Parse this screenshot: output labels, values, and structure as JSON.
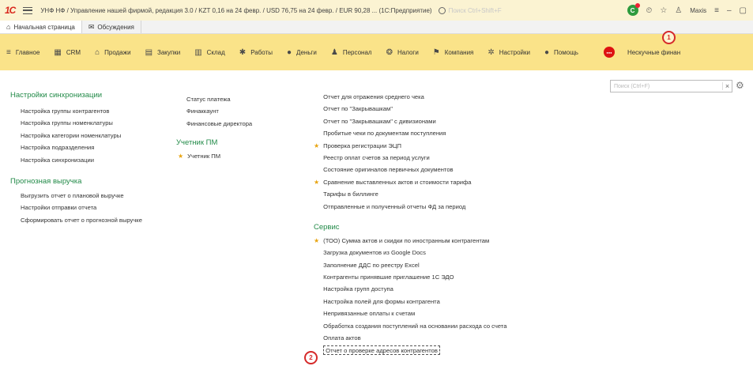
{
  "titlebar": {
    "logo": "1С",
    "title": "УНФ НФ / Управление нашей фирмой, редакция 3.0 / KZT 0,16 на 24 февр. / USD 76,75 на 24 февр. / EUR 90,28 ...   (1С:Предприятие)",
    "search_placeholder": "Поиск Ctrl+Shift+F",
    "user": "Maxis"
  },
  "tabs": [
    {
      "label": "Начальная страница",
      "icon": "home-icon"
    },
    {
      "label": "Обсуждения",
      "icon": "chat-icon"
    }
  ],
  "nav": [
    {
      "label": "Главное",
      "icon": "menu-icon"
    },
    {
      "label": "CRM",
      "icon": "crm-icon"
    },
    {
      "label": "Продажи",
      "icon": "shop-icon"
    },
    {
      "label": "Закупки",
      "icon": "purchase-icon"
    },
    {
      "label": "Склад",
      "icon": "warehouse-icon"
    },
    {
      "label": "Работы",
      "icon": "works-icon"
    },
    {
      "label": "Деньги",
      "icon": "money-icon"
    },
    {
      "label": "Персонал",
      "icon": "staff-icon"
    },
    {
      "label": "Налоги",
      "icon": "tax-icon"
    },
    {
      "label": "Компания",
      "icon": "flag-icon"
    },
    {
      "label": "Настройки",
      "icon": "gear-icon"
    },
    {
      "label": "Помощь",
      "icon": "help-icon"
    }
  ],
  "nav_extra": "Нескучные финан",
  "annotations": [
    "1",
    "2"
  ],
  "content": {
    "search_placeholder": "Поиск (Ctrl+F)",
    "col1": {
      "section1_title": "Настройки синхронизации",
      "section1_items": [
        "Настройка группы контрагентов",
        "Настройка группы номенклатуры",
        "Настройка категории номенклатуры",
        "Настройка подразделения",
        "Настройка синхронизации"
      ],
      "section2_title": "Прогнозная выручка",
      "section2_items": [
        "Выгрузить отчет о плановой выручке",
        "Настройки отправки отчета",
        "Сформировать отчет о прогнозной выручке"
      ]
    },
    "col2": {
      "items": [
        "Статус платежа",
        "Финаккаунт",
        "Финансовые директора"
      ],
      "section_title": "Учетник ПМ",
      "section_items": [
        "Учетник ПМ"
      ]
    },
    "col3": {
      "items": [
        {
          "label": "Отчет для отражения среднего чека",
          "star": false
        },
        {
          "label": "Отчет по \"Закрывашкам\"",
          "star": false
        },
        {
          "label": "Отчет по \"Закрывашкам\" с дивизионами",
          "star": false
        },
        {
          "label": "Пробитые чеки по документам поступления",
          "star": false
        },
        {
          "label": "Проверка регистрации ЭЦП",
          "star": true
        },
        {
          "label": "Реестр оплат счетов за период услуги",
          "star": false
        },
        {
          "label": "Состояние оригиналов первичных документов",
          "star": false
        },
        {
          "label": "Сравнение выставленных актов и стоимости тарифа",
          "star": true
        },
        {
          "label": "Тарифы в биллинге",
          "star": false
        },
        {
          "label": "Отправленные и полученный отчеты ФД за период",
          "star": false
        }
      ],
      "section_title": "Сервис",
      "section_items": [
        {
          "label": "(ТОО) Сумма актов и скидки по иностранным контрагентам",
          "star": true
        },
        {
          "label": "Загрузка документов из Google Docs",
          "star": false
        },
        {
          "label": "Заполнение ДДС по реестру Excel",
          "star": false
        },
        {
          "label": "Контрагенты принявшие приглашение 1С ЭДО",
          "star": false
        },
        {
          "label": "Настройка групп доступа",
          "star": false
        },
        {
          "label": "Настройка полей для формы контрагента",
          "star": false
        },
        {
          "label": "Непривязанные оплаты к счетам",
          "star": false
        },
        {
          "label": "Обработка создания поступлений на основании расхода со счета",
          "star": false
        },
        {
          "label": "Оплата актов",
          "star": false
        },
        {
          "label": "Отчет о проверке адресов контрагентов",
          "star": false
        }
      ]
    }
  }
}
